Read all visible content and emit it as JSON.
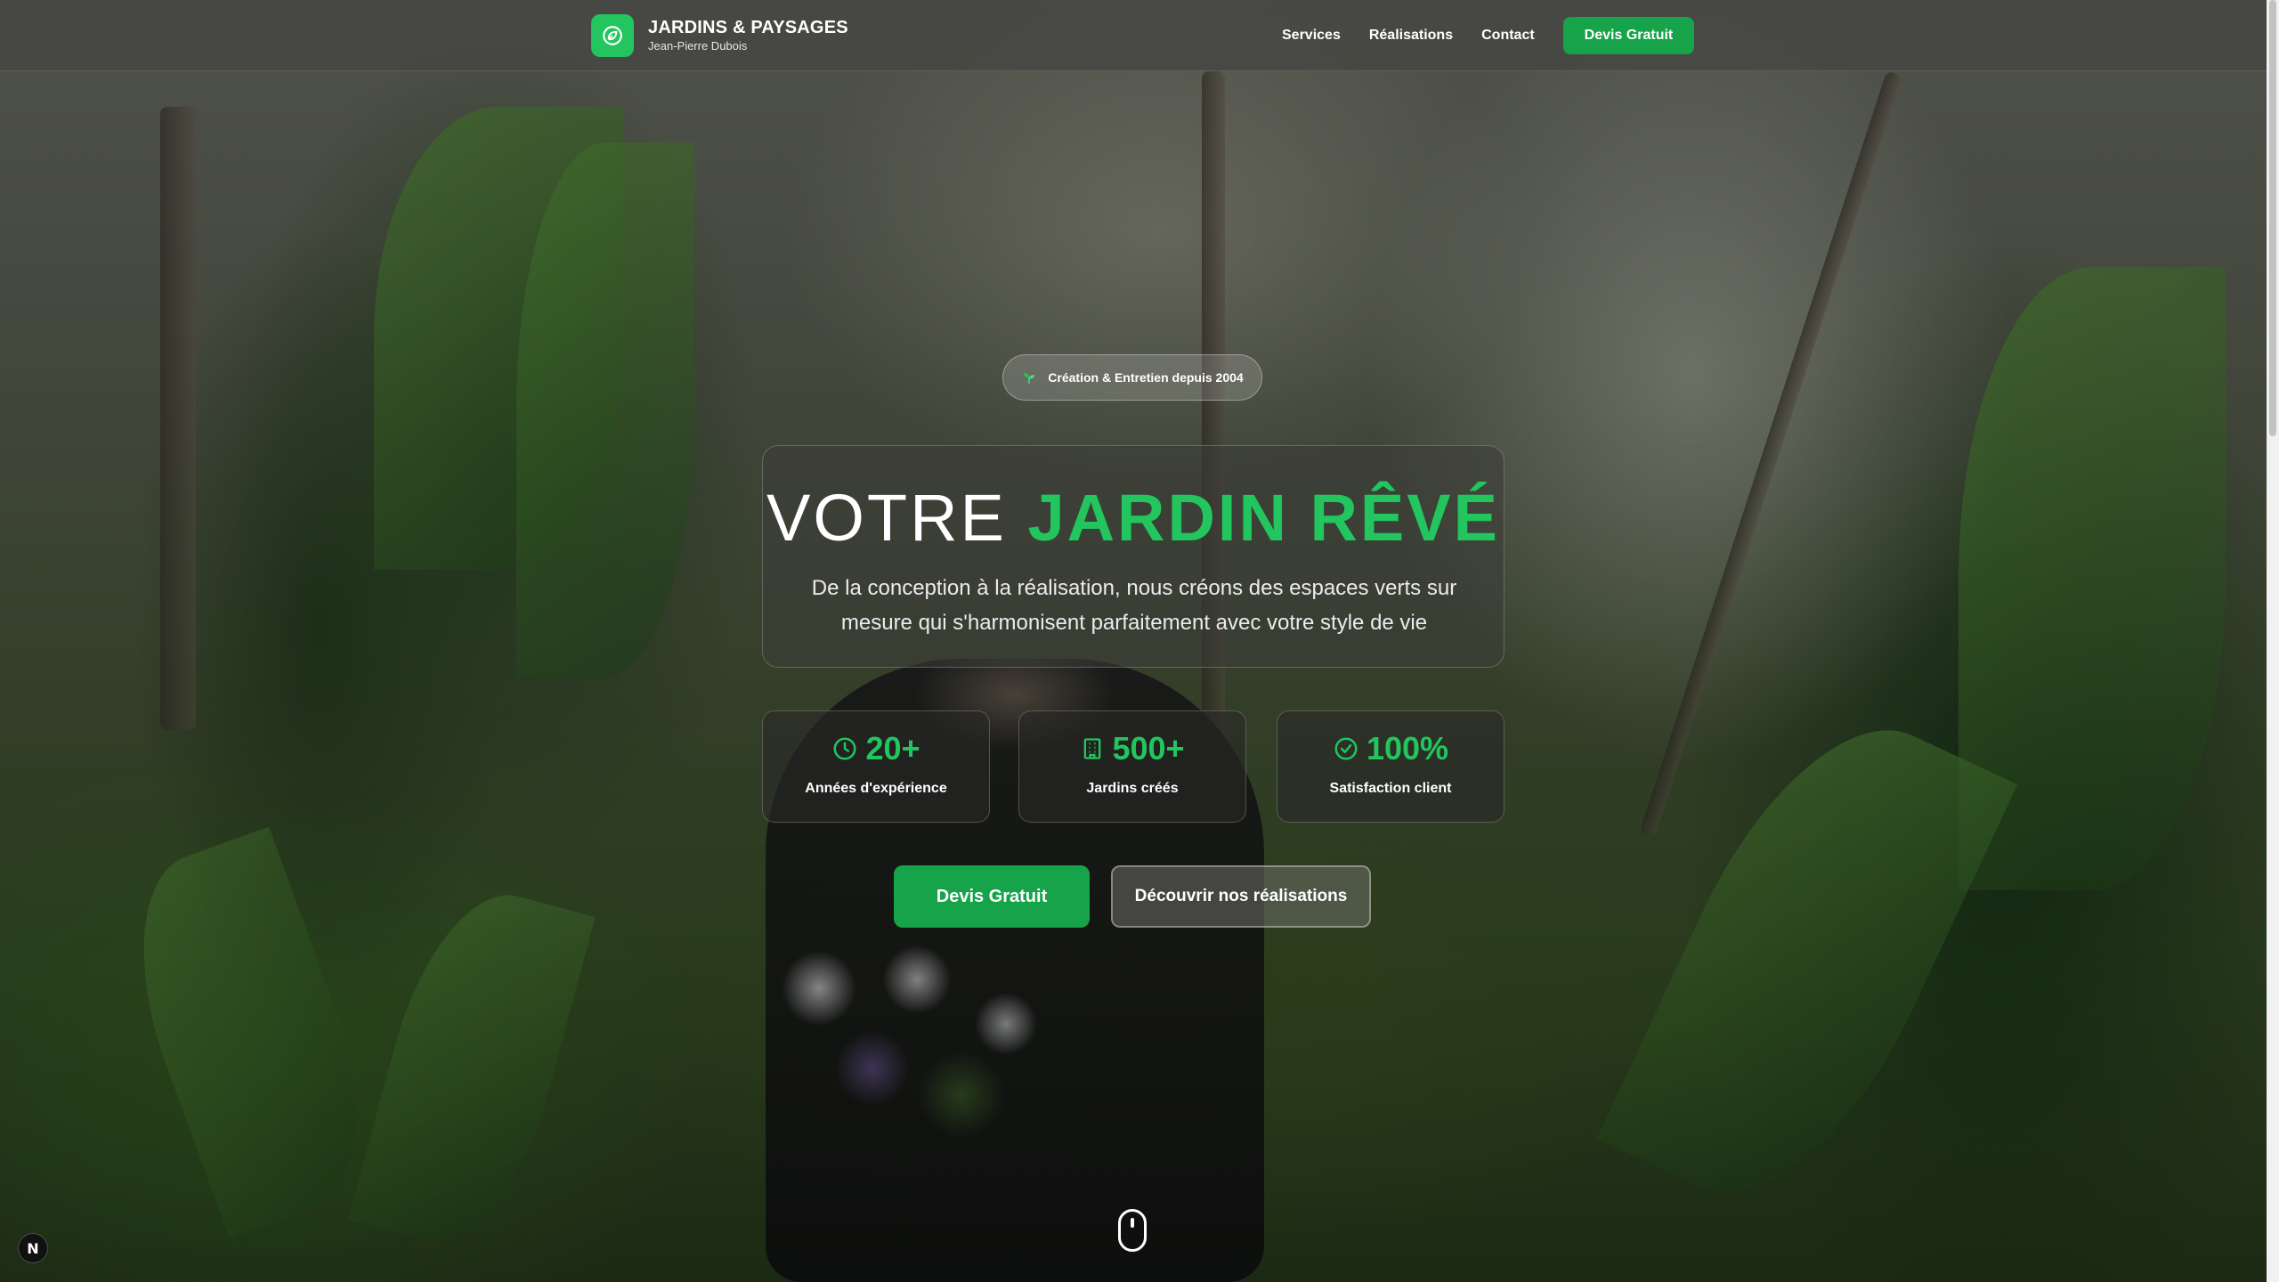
{
  "brand": {
    "title": "JARDINS & PAYSAGES",
    "subtitle": "Jean-Pierre Dubois",
    "icon": "leaf-logo-icon",
    "accent": "#22c55e"
  },
  "nav": {
    "links": [
      "Services",
      "Réalisations",
      "Contact"
    ],
    "cta": "Devis Gratuit",
    "cta_color": "#16a34a"
  },
  "hero": {
    "badge": "Création & Entretien depuis 2004",
    "badge_icon": "sprout-icon",
    "title_part1": "VOTRE",
    "title_part2": "JARDIN RÊVÉ",
    "description": "De la conception à la réalisation, nous créons des espaces verts sur mesure qui s'harmonisent parfaitement avec votre style de vie"
  },
  "stats": [
    {
      "value": "20+",
      "label": "Années d'expérience",
      "icon": "clock-icon"
    },
    {
      "value": "500+",
      "label": "Jardins créés",
      "icon": "building-icon"
    },
    {
      "value": "100%",
      "label": "Satisfaction client",
      "icon": "check-circle-icon"
    }
  ],
  "actions": {
    "primary": "Devis Gratuit",
    "secondary": "Découvrir nos réalisations"
  },
  "corner_badge": "N",
  "scroll_indicator": "mouse-scroll-icon"
}
